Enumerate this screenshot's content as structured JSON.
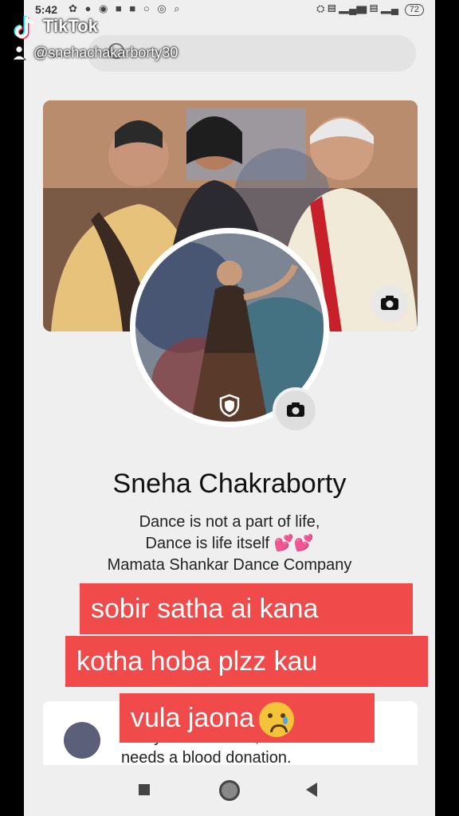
{
  "status_bar": {
    "time": "5:42",
    "battery": "72"
  },
  "tiktok": {
    "brand": "TikTok",
    "username": "@snehachakarborty30"
  },
  "profile": {
    "name": "Sneha Chakraborty",
    "bio_line1": "Dance is not a part of life,",
    "bio_line2": "Dance is life itself",
    "bio_hearts": "💕💕",
    "bio_line3": "Mamata Shankar Dance Company"
  },
  "post_preview": {
    "text_line1": "Every two seconds, someone",
    "text_line2": "needs a blood donation."
  },
  "caption": {
    "line1": "sobir satha ai kana",
    "line2": "kotha  hoba plzz kau",
    "line3": "vula jaona"
  },
  "icons": {
    "back": "back-arrow-icon",
    "search": "search-icon",
    "cover_camera": "camera-icon",
    "avatar_camera": "camera-icon",
    "shield": "shield-icon",
    "emoji": "crying-face-icon"
  },
  "colors": {
    "caption_bg": "#f04a4a",
    "page_bg": "#efefef"
  }
}
